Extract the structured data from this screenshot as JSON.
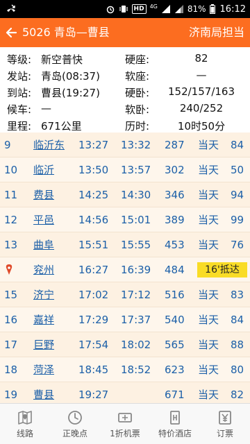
{
  "status_bar": {
    "battery": "81%",
    "time": "16:12",
    "hd_label": "HD",
    "network_label": "4G"
  },
  "header": {
    "title": "5026 青岛—曹县",
    "bureau": "济南局担当"
  },
  "info": {
    "grade_label": "等级:",
    "grade_value": "新空普快",
    "hard_seat_label": "硬座:",
    "hard_seat_value": "82",
    "from_label": "发站:",
    "from_value": "青岛(08:37)",
    "soft_seat_label": "软座:",
    "soft_seat_value": "—",
    "to_label": "到站:",
    "to_value": "曹县(19:27)",
    "hard_sleeper_label": "硬卧:",
    "hard_sleeper_value": "152/157/163",
    "wait_label": "候车:",
    "wait_value": "—",
    "soft_sleeper_label": "软卧:",
    "soft_sleeper_value": "240/252",
    "distance_label": "里程:",
    "distance_value": "671公里",
    "duration_label": "历时:",
    "duration_value": "10时50分"
  },
  "stops": [
    {
      "no": "9",
      "name": "临沂东",
      "arrive": "13:27",
      "depart": "13:32",
      "km": "287",
      "day": "当天",
      "price": "84"
    },
    {
      "no": "10",
      "name": "临沂",
      "arrive": "13:50",
      "depart": "13:57",
      "km": "302",
      "day": "当天",
      "price": "50"
    },
    {
      "no": "11",
      "name": "费县",
      "arrive": "14:25",
      "depart": "14:30",
      "km": "346",
      "day": "当天",
      "price": "94"
    },
    {
      "no": "12",
      "name": "平邑",
      "arrive": "14:56",
      "depart": "15:01",
      "km": "389",
      "day": "当天",
      "price": "99"
    },
    {
      "no": "13",
      "name": "曲阜",
      "arrive": "15:51",
      "depart": "15:55",
      "km": "453",
      "day": "当天",
      "price": "76"
    },
    {
      "no": "",
      "name": "兖州",
      "arrive": "16:27",
      "depart": "16:39",
      "km": "484",
      "day": "16'抵达",
      "price": ""
    },
    {
      "no": "15",
      "name": "济宁",
      "arrive": "17:02",
      "depart": "17:12",
      "km": "516",
      "day": "当天",
      "price": "83"
    },
    {
      "no": "16",
      "name": "嘉祥",
      "arrive": "17:29",
      "depart": "17:37",
      "km": "540",
      "day": "当天",
      "price": "84"
    },
    {
      "no": "17",
      "name": "巨野",
      "arrive": "17:54",
      "depart": "18:02",
      "km": "565",
      "day": "当天",
      "price": "88"
    },
    {
      "no": "18",
      "name": "菏泽",
      "arrive": "18:45",
      "depart": "18:52",
      "km": "623",
      "day": "当天",
      "price": "80"
    },
    {
      "no": "19",
      "name": "曹县",
      "arrive": "19:27",
      "depart": "",
      "km": "671",
      "day": "当天",
      "price": "82"
    }
  ],
  "nav": [
    {
      "label": "线路",
      "icon": "map-icon"
    },
    {
      "label": "正晚点",
      "icon": "clock-icon"
    },
    {
      "label": "1折机票",
      "icon": "ticket-icon"
    },
    {
      "label": "特价酒店",
      "icon": "hotel-icon"
    },
    {
      "label": "订票",
      "icon": "yen-icon"
    }
  ],
  "colors": {
    "header_bg": "#fc6d20",
    "stop_text": "#1b5fa8",
    "stop_bg": "#fdf1e2",
    "current_tag": "#f9dc26"
  }
}
